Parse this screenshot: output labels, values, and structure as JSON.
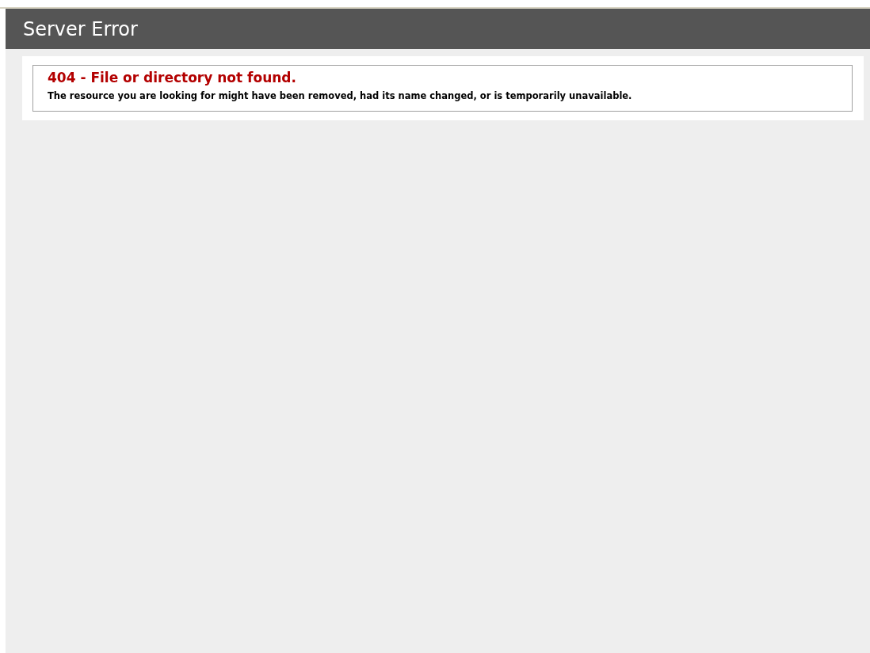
{
  "header": {
    "title": "Server Error"
  },
  "error": {
    "heading": "404 - File or directory not found.",
    "message": "The resource you are looking for might have been removed, had its name changed, or is temporarily unavailable."
  }
}
